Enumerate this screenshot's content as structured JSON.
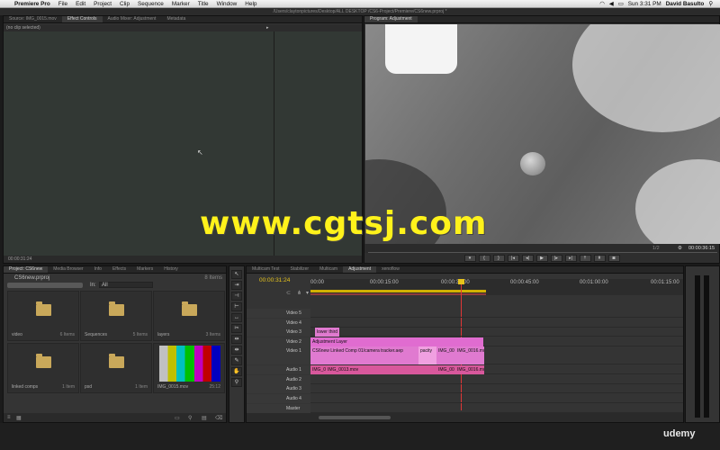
{
  "menubar": {
    "app": "Premiere Pro",
    "items": [
      "File",
      "Edit",
      "Project",
      "Clip",
      "Sequence",
      "Marker",
      "Title",
      "Window",
      "Help"
    ],
    "clock": "Sun 3:31 PM",
    "user": "David Basulto"
  },
  "window_title": "/Users/claytonpictures/Desktop/ALL DESKTOP /CS6-Project/Premiere/CS6new.prproj *",
  "effect_controls": {
    "tabs": [
      "Source: IMG_0015.mov",
      "Effect Controls",
      "Audio Mixer: Adjustment",
      "Metadata"
    ],
    "no_clip": "(no clip selected)",
    "timecode": "00:00:31:24"
  },
  "program_monitor": {
    "tab": "Program: Adjustment",
    "zoom": "1/2",
    "timecode": "00:00:36:15"
  },
  "project": {
    "tabs": [
      "Project: CS6new",
      "Media Browser",
      "Info",
      "Effects",
      "Markers",
      "History"
    ],
    "file": "CS6new.prproj",
    "item_count": "8 Items",
    "in_label": "In:",
    "in_value": "All",
    "items": [
      {
        "name": "video",
        "count": "6 Items"
      },
      {
        "name": "Sequences",
        "count": "5 Items"
      },
      {
        "name": "layers",
        "count": "3 Items"
      },
      {
        "name": "linked comps",
        "count": "1 Item"
      },
      {
        "name": "psd",
        "count": "1 Item"
      },
      {
        "name": "IMG_0015.mov",
        "count": "25:12"
      }
    ]
  },
  "timeline": {
    "tabs": [
      "Multicam Test",
      "Stabilizer",
      "Multicam",
      "Adjustment",
      "xenoflow"
    ],
    "timecode": "00:00:31:24",
    "ruler": [
      "00:00",
      "00:00:15:00",
      "00:00:30:00",
      "00:00:45:00",
      "00:01:00:00",
      "00:01:15:00"
    ],
    "tracks": [
      "Video 5",
      "Video 4",
      "Video 3",
      "Video 2",
      "Video 1",
      "Audio 1",
      "Audio 2",
      "Audio 3",
      "Audio 4",
      "Master"
    ],
    "clips": {
      "v3": "lower third",
      "v2": "Adjustment Layer",
      "v1a": "CS6new Linked Comp 01/camera tracker.aep",
      "v1b": "pacity",
      "v1c": "IMG_00",
      "v1d": "IMG_0016.mo",
      "a1a": "IMG_0",
      "a1b": "IMG_0013.mov",
      "a1c": "IMG_00",
      "a1d": "IMG_0016.mo"
    }
  },
  "watermark": "www.cgtsj.com",
  "brand": "udemy",
  "colors": {
    "accent": "#e060b8",
    "audio": "#d8589c",
    "folder": "#c9a85a",
    "timecode": "#e6c31c"
  }
}
